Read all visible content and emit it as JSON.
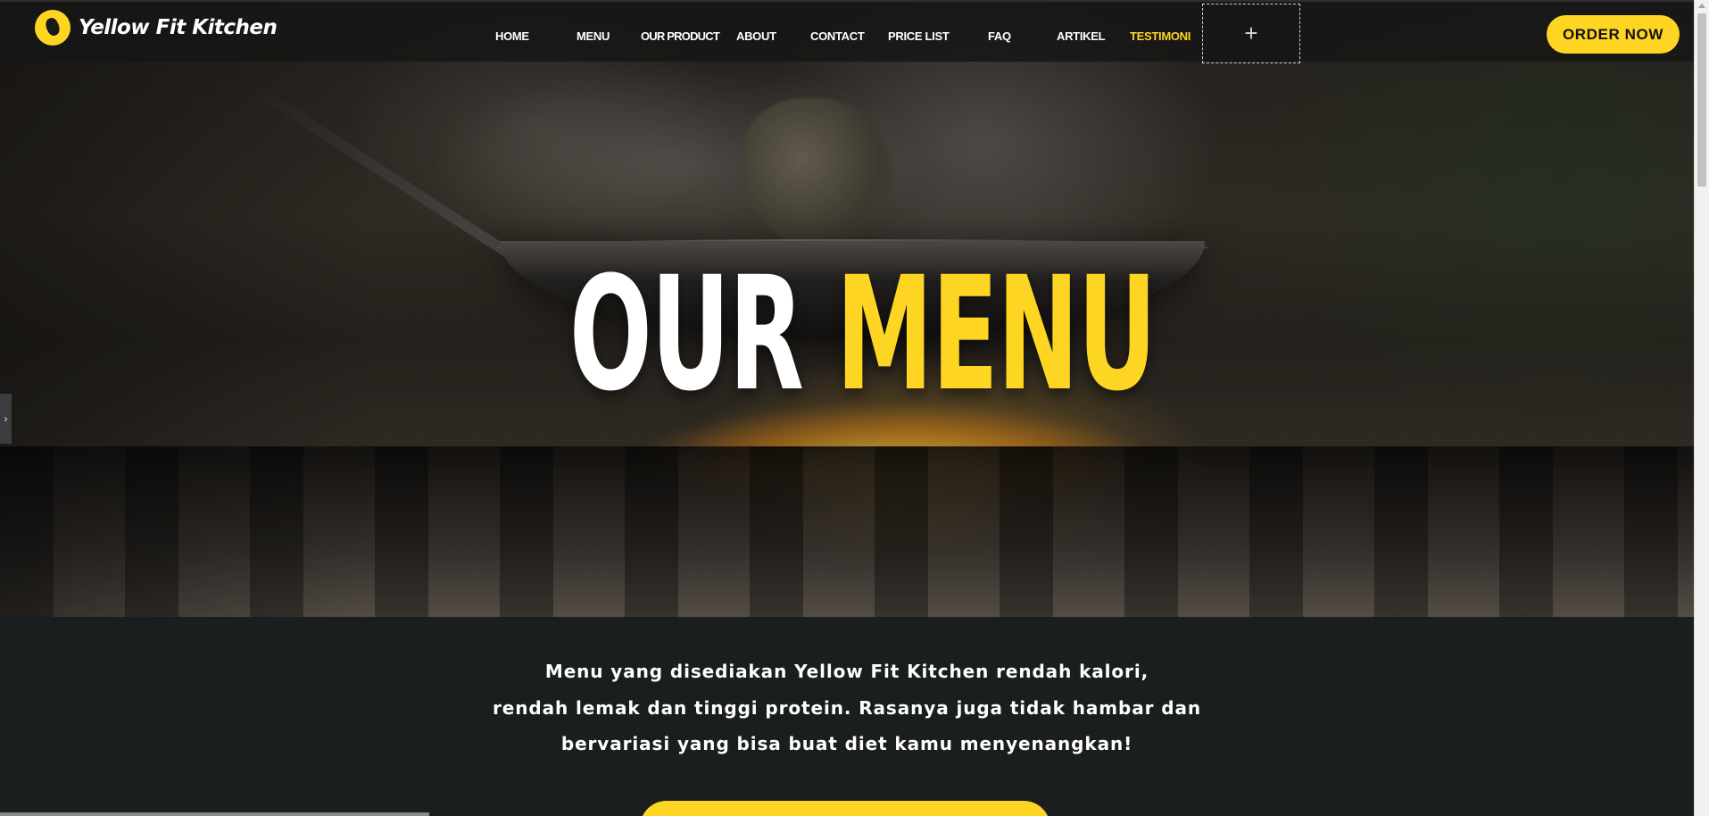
{
  "brand": {
    "name": "Yellow Fit Kitchen",
    "accent_color": "#ffd523",
    "logo_icon": "runner-icon"
  },
  "nav": {
    "items": [
      {
        "label": "HOME",
        "active": false
      },
      {
        "label": "MENU",
        "active": false
      },
      {
        "label": "OUR PRODUCT",
        "active": false
      },
      {
        "label": "ABOUT",
        "active": false
      },
      {
        "label": "CONTACT",
        "active": false
      },
      {
        "label": "PRICE LIST",
        "active": false
      },
      {
        "label": "FAQ",
        "active": false
      },
      {
        "label": "ARTIKEL",
        "active": false
      },
      {
        "label": "TESTIMONI",
        "active": true
      }
    ],
    "add_icon": "plus-icon",
    "add_glyph": "+"
  },
  "header": {
    "order_label": "ORDER NOW"
  },
  "hero": {
    "title_white": "OUR",
    "title_yellow": "MENU"
  },
  "side_tab": {
    "icon": "chevron-right-icon",
    "glyph": "›"
  },
  "description": {
    "lines": [
      "Menu yang disediakan Yellow Fit Kitchen rendah kalori,",
      "rendah lemak dan tinggi protein. Rasanya juga tidak hambar dan",
      "bervariasi yang bisa buat diet kamu menyenangkan!"
    ]
  }
}
